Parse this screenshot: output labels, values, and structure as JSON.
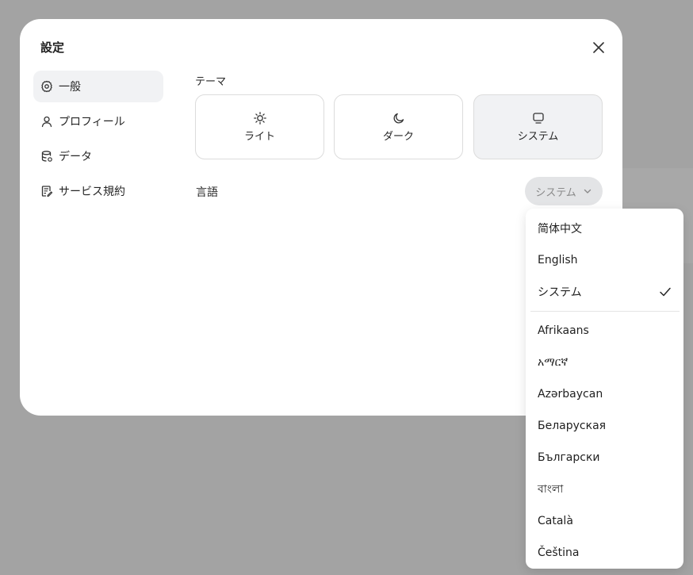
{
  "dialog": {
    "title": "設定",
    "close_icon": "close-icon"
  },
  "sidebar": {
    "items": [
      {
        "label": "一般",
        "icon": "gear-icon",
        "active": true
      },
      {
        "label": "プロフィール",
        "icon": "user-icon",
        "active": false
      },
      {
        "label": "データ",
        "icon": "database-icon",
        "active": false
      },
      {
        "label": "サービス規約",
        "icon": "document-icon",
        "active": false
      }
    ]
  },
  "theme": {
    "label": "テーマ",
    "options": [
      {
        "label": "ライト",
        "icon": "sun-icon",
        "selected": false
      },
      {
        "label": "ダーク",
        "icon": "moon-icon",
        "selected": false
      },
      {
        "label": "システム",
        "icon": "monitor-icon",
        "selected": true
      }
    ]
  },
  "language": {
    "label": "言語",
    "selected_value": "システム",
    "chevron_icon": "chevron-down-icon"
  },
  "language_menu": {
    "items": [
      {
        "label": "简体中文",
        "checked": false
      },
      {
        "label": "English",
        "checked": false
      },
      {
        "label": "システム",
        "checked": true
      },
      {
        "label": "Afrikaans",
        "checked": false
      },
      {
        "label": "አማርኛ",
        "checked": false
      },
      {
        "label": "Azərbaycan",
        "checked": false
      },
      {
        "label": "Беларуская",
        "checked": false
      },
      {
        "label": "Български",
        "checked": false
      },
      {
        "label": "বাংলা",
        "checked": false
      },
      {
        "label": "Català",
        "checked": false
      },
      {
        "label": "Čeština",
        "checked": false
      }
    ]
  },
  "colors": {
    "overlay": "#a3a3a3",
    "dialog_bg": "#ffffff",
    "active_bg": "#f1f2f4",
    "text": "#262626",
    "muted_text": "#8a8a8a"
  }
}
